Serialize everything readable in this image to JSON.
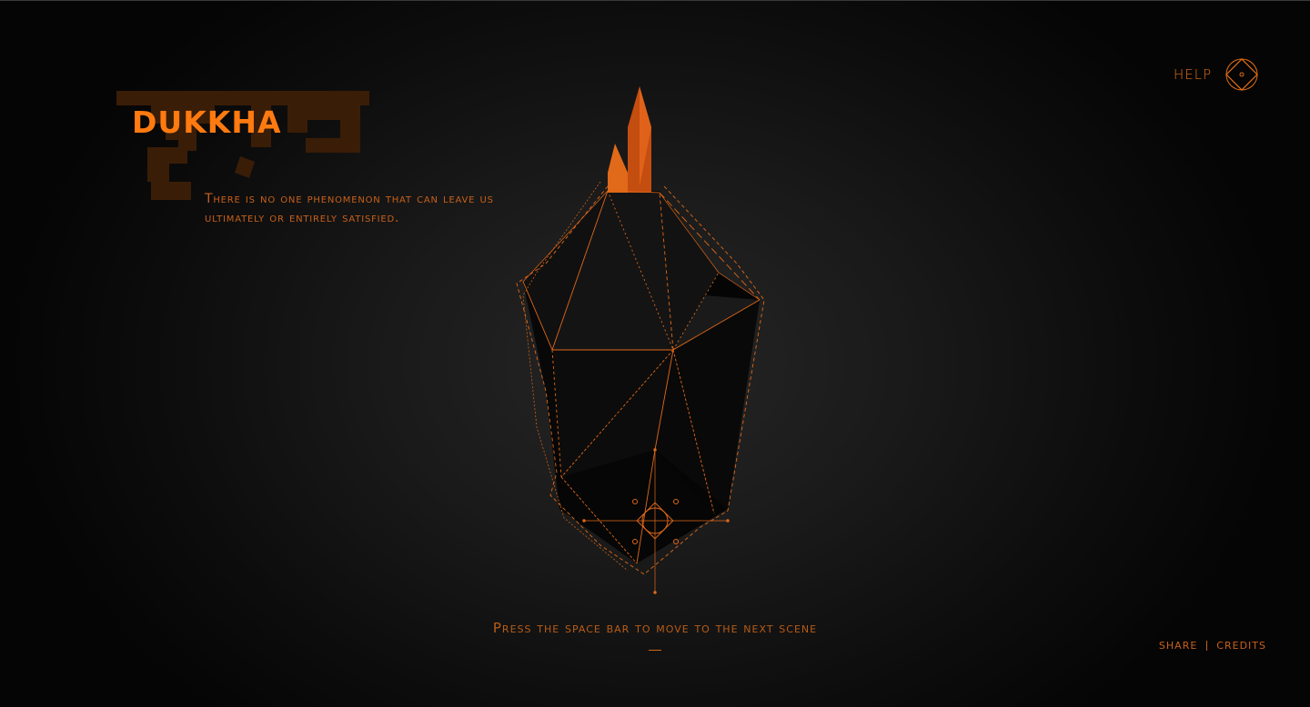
{
  "scene": {
    "title": "DUKKHA",
    "devanagari_watermark": "दुःख",
    "description": "There is no one phenomenon that can leave us ultimately or entirely satisfied."
  },
  "header": {
    "help_label": "HELP",
    "help_icon": "diamond-target-icon"
  },
  "prompt": {
    "text": "Press the space bar to move to the next scene"
  },
  "footer": {
    "share_label": "SHARE",
    "credits_label": "CREDITS"
  },
  "colors": {
    "accent": "#ff7a10",
    "accent_dim": "#c8601a",
    "watermark": "#3d1f08",
    "background": "#161616"
  }
}
